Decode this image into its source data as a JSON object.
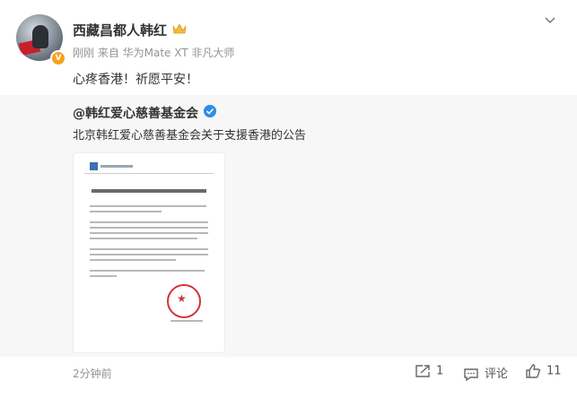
{
  "post": {
    "author": "西藏昌都人韩红",
    "meta": "刚刚 来自 华为Mate XT 非凡大师",
    "text": "心疼香港！祈愿平安！"
  },
  "repost": {
    "author": "@韩红爱心慈善基金会",
    "text": "北京韩红爱心慈善基金会关于支援香港的公告"
  },
  "footer": {
    "time": "2分钟前",
    "share_count": "1",
    "comment_label": "评论",
    "like_count": "11"
  },
  "colors": {
    "verified_orange": "#f7a21b",
    "verified_blue": "#2e8de6",
    "repost_bg": "#f7f7f7",
    "seal_red": "#d0333a"
  },
  "icons": [
    "crown-icon",
    "chevron-down-icon",
    "verified-icon",
    "share-icon",
    "comment-icon",
    "like-icon"
  ]
}
